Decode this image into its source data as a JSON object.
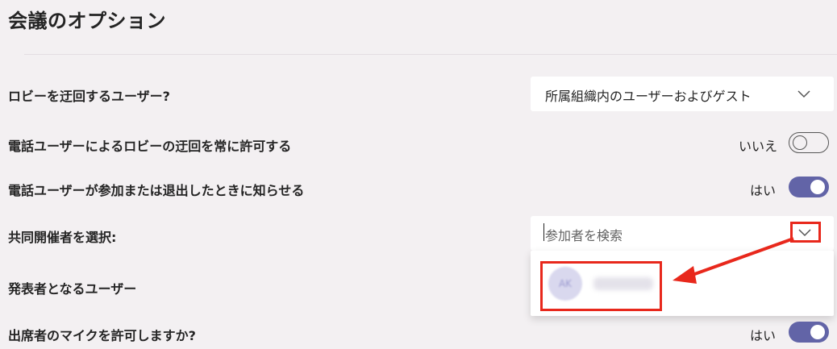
{
  "page": {
    "title": "会議のオプション"
  },
  "options": {
    "bypass_lobby": {
      "label": "ロビーを迂回するユーザー?",
      "value": "所属組織内のユーザーおよびゲスト"
    },
    "phone_bypass": {
      "label": "電話ユーザーによるロビーの迂回を常に許可する",
      "state_text": "いいえ",
      "on": false
    },
    "phone_notify": {
      "label": "電話ユーザーが参加または退出したときに知らせる",
      "state_text": "はい",
      "on": true
    },
    "co_organizers": {
      "label": "共同開催者を選択:",
      "placeholder": "参加者を検索"
    },
    "presenters": {
      "label": "発表者となるユーザー"
    },
    "allow_mic": {
      "label": "出席者のマイクを許可しますか?",
      "state_text": "はい",
      "on": true
    }
  },
  "colors": {
    "accent": "#6264a7",
    "annotation": "#e8281c",
    "background": "#f3f0f2"
  }
}
